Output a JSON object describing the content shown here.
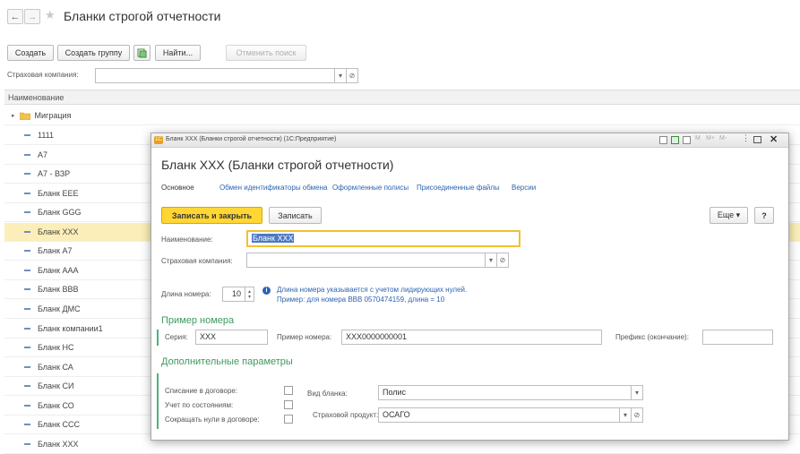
{
  "window": {
    "title": "Бланки строгой отчетности",
    "nav_back": "←",
    "nav_forward": "→",
    "star": "★"
  },
  "toolbar": {
    "create_label": "Создать",
    "create_group_label": "Создать группу",
    "find_label": "Найти...",
    "cancel_search_label": "Отменить поиск"
  },
  "filter": {
    "label": "Страховая компания:",
    "value": ""
  },
  "list": {
    "column_header": "Наименование",
    "group_item": "Миграция",
    "items": [
      "1111",
      "А7",
      "А7 - ВЗР",
      "Бланк EEE",
      "Бланк GGG",
      "Бланк XXX",
      "Бланк А7",
      "Бланк ААА",
      "Бланк ВВВ",
      "Бланк ДМС",
      "Бланк компании1",
      "Бланк НС",
      "Бланк СА",
      "Бланк СИ",
      "Бланк СО",
      "Бланк ССС",
      "Бланк ХХХ"
    ],
    "selected_index": 5
  },
  "dialog": {
    "titlebar": "Бланк XXX (Бланки строгой отчетности) (1С:Предприятие)",
    "app_badge": "1С",
    "window_controls": [
      "M",
      "M+",
      "M-"
    ],
    "heading": "Бланк XXX (Бланки строгой отчетности)",
    "tabs": [
      "Основное",
      "Обмен идентификаторы обмена",
      "Оформленные полисы",
      "Присоединенные файлы",
      "Версии"
    ],
    "save_close_label": "Записать и закрыть",
    "save_label": "Записать",
    "more_label": "Еще ▾",
    "help_label": "?",
    "name_label": "Наименование:",
    "name_value": "Бланк XXX",
    "company_label": "Страховая компания:",
    "company_value": "",
    "length_label": "Длина номера:",
    "length_value": "10",
    "hint_line1": "Длина номера указывается с учетом лидирующих нулей.",
    "hint_line2": "Пример: для номера ВВВ 0570474159, длина = 10",
    "example_section": "Пример номера",
    "series_label": "Серия:",
    "series_value": "XXX",
    "example_number_label": "Пример номера:",
    "example_number_value": "XXX0000000001",
    "prefix_label": "Префикс (окончание):",
    "prefix_value": "",
    "extra_section": "Дополнительные параметры",
    "writeoff_label": "Списание в договоре:",
    "state_label": "Учет по состояниям:",
    "trim_zeros_label": "Сокращать нули в договоре:",
    "form_type_label": "Вид бланка:",
    "form_type_value": "Полис",
    "product_label": "Страховой продукт:",
    "product_value": "ОСАГО"
  },
  "colors": {
    "accent_yellow": "#ffd633",
    "selection": "#fbeeb8",
    "link": "#2d64b1",
    "section_green": "#3c9a5f"
  }
}
